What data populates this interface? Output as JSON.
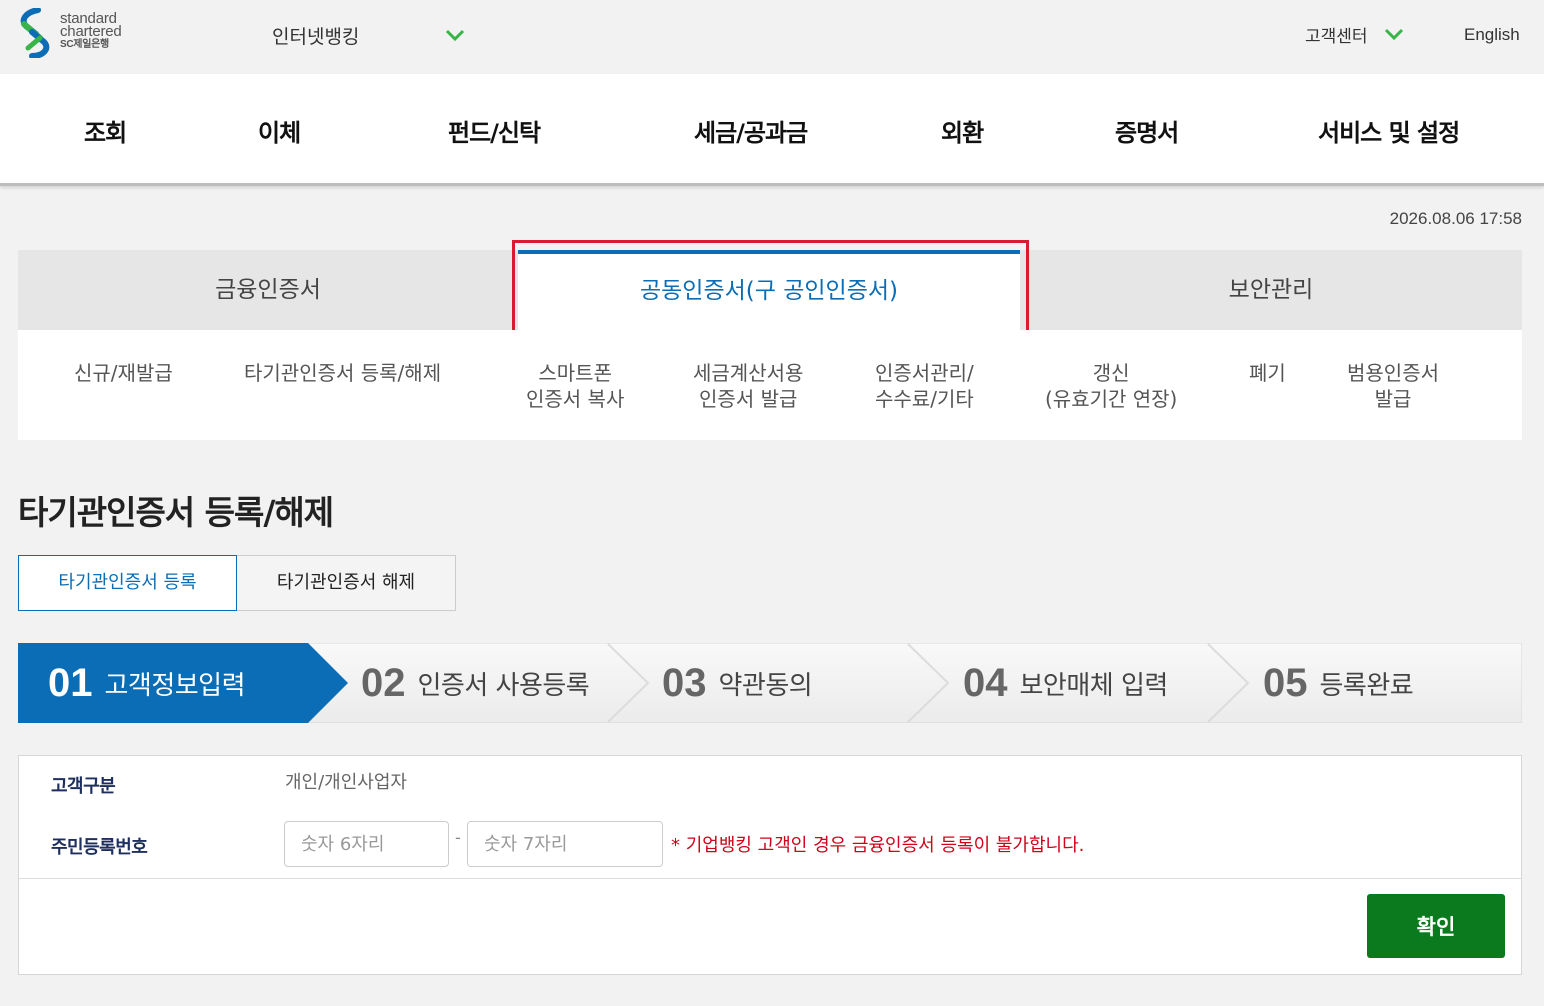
{
  "brand": {
    "line1": "standard",
    "line2": "chartered",
    "line3": "SC제일은행",
    "colors": {
      "blue": "#0a6db5",
      "green": "#38b449"
    }
  },
  "header": {
    "site_select": "인터넷뱅킹",
    "customer_center": "고객센터",
    "language": "English"
  },
  "gnb": {
    "items": [
      "조회",
      "이체",
      "펀드/신탁",
      "세금/공과금",
      "외환",
      "증명서",
      "서비스 및 설정"
    ]
  },
  "datetime": "2026.08.06 17:58",
  "tabs": [
    {
      "label": "금융인증서",
      "active": false
    },
    {
      "label": "공동인증서(구 공인인증서)",
      "active": true
    },
    {
      "label": "보안관리",
      "active": false
    }
  ],
  "submenu": [
    {
      "line1": "신규/재발급",
      "line2": ""
    },
    {
      "line1": "타기관인증서 등록/해제",
      "line2": ""
    },
    {
      "line1": "스마트폰",
      "line2": "인증서 복사"
    },
    {
      "line1": "세금계산서용",
      "line2": "인증서 발급"
    },
    {
      "line1": "인증서관리/",
      "line2": "수수료/기타"
    },
    {
      "line1": "갱신",
      "line2": "(유효기간 연장)"
    },
    {
      "line1": "폐기",
      "line2": ""
    },
    {
      "line1": "범용인증서",
      "line2": "발급"
    }
  ],
  "page_title": "타기관인증서 등록/해제",
  "segments": {
    "register": "타기관인증서 등록",
    "release": "타기관인증서 해제"
  },
  "steps": [
    {
      "num": "01",
      "label": "고객정보입력",
      "current": true
    },
    {
      "num": "02",
      "label": "인증서 사용등록",
      "current": false
    },
    {
      "num": "03",
      "label": "약관동의",
      "current": false
    },
    {
      "num": "04",
      "label": "보안매체 입력",
      "current": false
    },
    {
      "num": "05",
      "label": "등록완료",
      "current": false
    }
  ],
  "form": {
    "customer_type_label": "고객구분",
    "customer_type_value": "개인/개인사업자",
    "rrn_label": "주민등록번호",
    "rrn_front_placeholder": "숫자 6자리",
    "rrn_back_placeholder": "숫자 7자리",
    "dash": "-",
    "note": "* 기업뱅킹 고객인 경우 금융인증서 등록이 불가합니다.",
    "confirm": "확인"
  }
}
